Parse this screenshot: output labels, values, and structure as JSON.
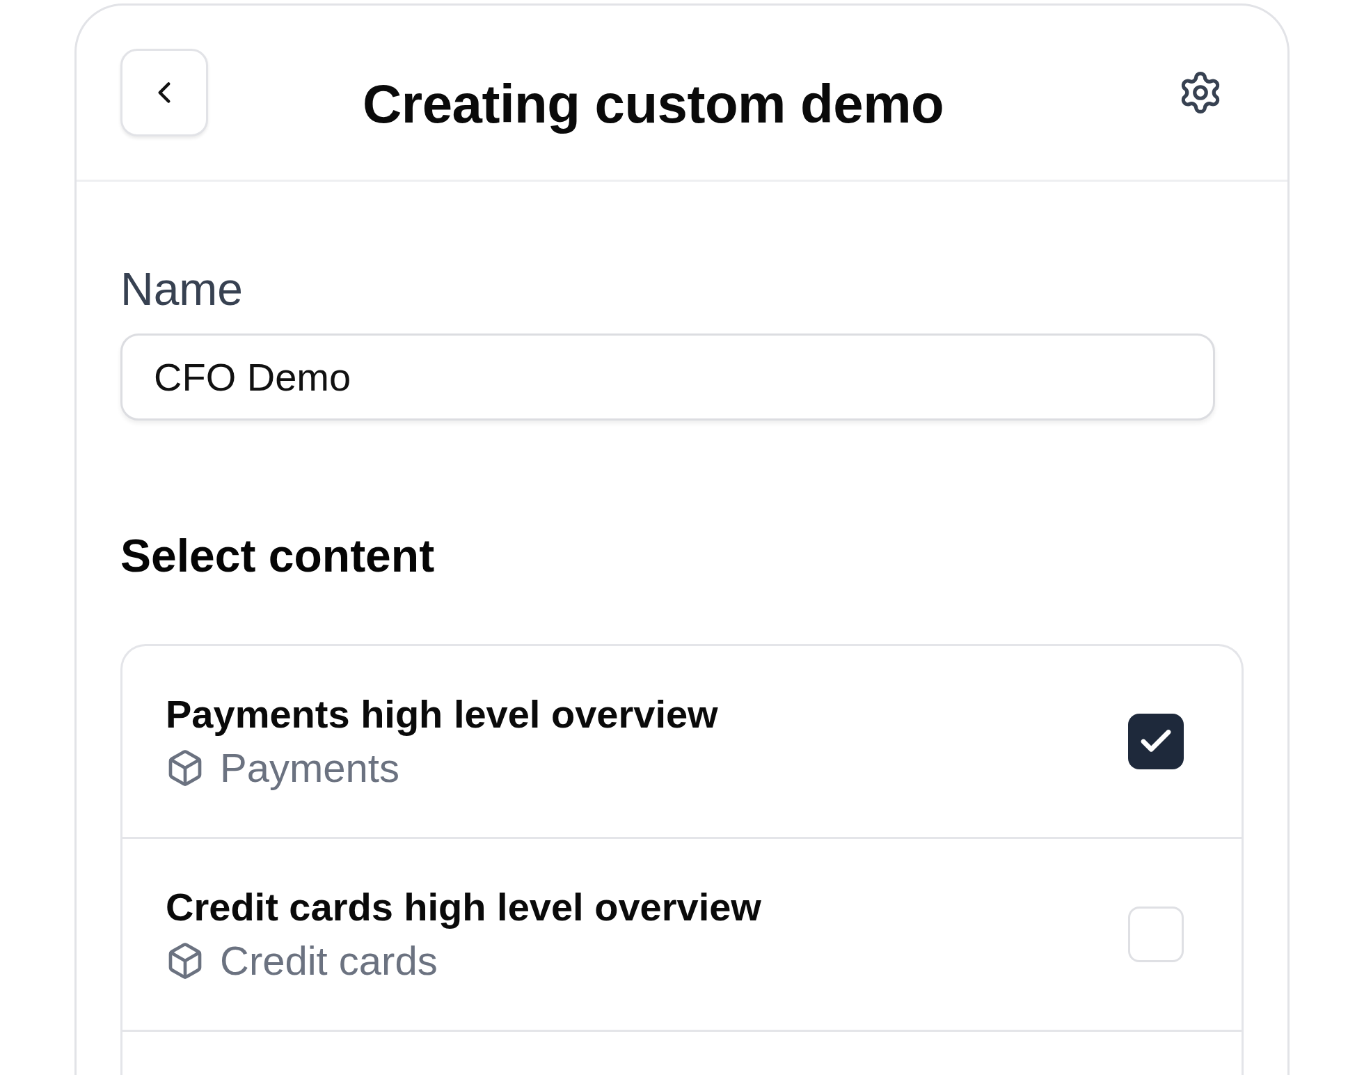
{
  "header": {
    "title": "Creating custom demo"
  },
  "name_field": {
    "label": "Name",
    "value": "CFO Demo"
  },
  "content": {
    "heading": "Select content",
    "items": [
      {
        "title": "Payments high level overview",
        "category": "Payments",
        "checked": true
      },
      {
        "title": "Credit cards high level overview",
        "category": "Credit cards",
        "checked": false
      }
    ]
  }
}
